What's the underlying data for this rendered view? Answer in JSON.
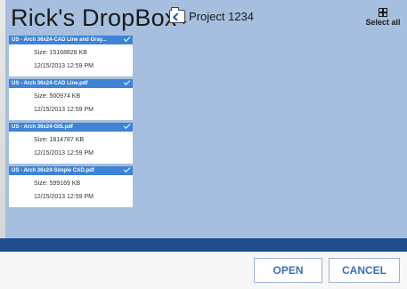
{
  "header": {
    "title": "Rick's DropBox",
    "title_chevron": "⌄",
    "folder_name": "Project 1234",
    "select_all_label": "Select all"
  },
  "files": [
    {
      "name": "US - Arch 36x24-CAD Line and Gray...",
      "size": "Size: 15168828 KB",
      "date": "12/15/2013 12:59 PM",
      "selected": true
    },
    {
      "name": "US - Arch 36x24-CAD Line.pdf",
      "size": "Size: 500974 KB",
      "date": "12/15/2013 12:59 PM",
      "selected": true
    },
    {
      "name": "US - Arch 36x24-GIS.pdf",
      "size": "Size: 1814787 KB",
      "date": "12/15/2013 12:59 PM",
      "selected": true
    },
    {
      "name": "US - Arch 36x24-Simple CAD.pdf",
      "size": "Size: 599169 KB",
      "date": "12/15/2013 12:59 PM",
      "selected": true
    }
  ],
  "footer": {
    "open_label": "OPEN",
    "cancel_label": "CANCEL"
  },
  "colors": {
    "panel_bg": "#a6bfde",
    "file_header": "#3f83d5",
    "bottom_bar": "#1f4c8f",
    "button_text": "#3e6fb0"
  },
  "icons": {
    "folder": "folder-up-icon",
    "select_all": "grid-icon",
    "check": "check-icon"
  }
}
